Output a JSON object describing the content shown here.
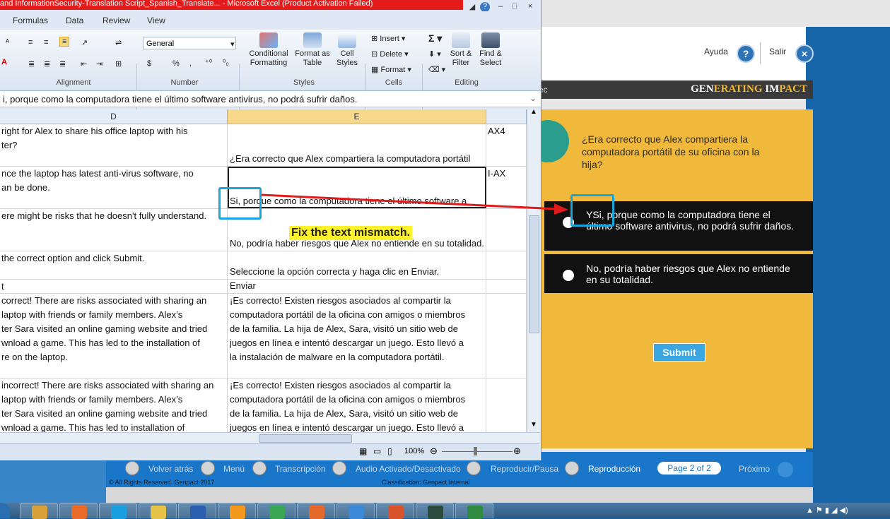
{
  "excel": {
    "title": "and InformationSecurity-Translation Script_Spanish_Translate...  -  Microsoft Excel (Product Activation Failed)",
    "window_controls": [
      "?",
      "–",
      "□",
      "×"
    ],
    "menu": [
      "Formulas",
      "Data",
      "Review",
      "View"
    ],
    "ribbon": {
      "number_format": "General",
      "groups": [
        "Alignment",
        "Number",
        "Styles",
        "Cells",
        "Editing"
      ],
      "styles_buttons": [
        "Conditional Formatting",
        "Format as Table",
        "Cell Styles"
      ],
      "cells_buttons": [
        "Insert",
        "Delete",
        "Format"
      ],
      "editing_buttons": [
        "Sort & Filter",
        "Find & Select"
      ],
      "number_symbols": [
        "$",
        "%",
        ","
      ]
    },
    "formula_bar": "i, porque como la computadora tiene el último software antivirus, no podrá sufrir daños.",
    "columns": [
      "D",
      "E"
    ],
    "rows": [
      {
        "d": [
          "right for Alex to share his office laptop with his",
          "ter?"
        ],
        "e_bottom": "¿Era correcto que Alex compartiera la computadora portátil",
        "f": "AX4",
        "h": 60
      },
      {
        "d": [
          "nce the laptop has latest anti-virus software, no",
          "an be done."
        ],
        "e_bottom": "Si, porque como la computadora tiene el último software a",
        "f": "I-AX",
        "h": 60
      },
      {
        "d": [
          "ere might be risks that he doesn't fully understand."
        ],
        "e_bottom": "No, podría haber riesgos que Alex no entiende en su totalidad.",
        "f": "",
        "h": 60
      },
      {
        "d": [
          "the correct option and click Submit."
        ],
        "e_bottom": "Seleccione la opción correcta y haga clic en Enviar.",
        "f": "",
        "h": 40
      },
      {
        "d": [
          "t"
        ],
        "e_bottom": "Enviar",
        "f": "",
        "h": 20
      },
      {
        "d": [
          "correct! There are risks associated with sharing an",
          "laptop with friends or family members. Alex’s",
          "ter Sara visited an online gaming website and tried",
          "wnload a game. This has led to the installation of",
          "re on the laptop."
        ],
        "e_lines": [
          "¡Es correcto! Existen riesgos asociados al compartir la",
          "computadora portátil de la oficina con amigos o miembros",
          "de la familia. La hija de Alex, Sara, visitó un sitio web de",
          "juegos en línea e intentó descargar un juego. Esto llevó a",
          "la instalación de malware en la computadora portátil."
        ],
        "f": "",
        "h": 120
      },
      {
        "d": [
          "incorrect! There are risks associated with sharing an",
          "laptop with friends or family members. Alex’s",
          "ter Sara visited an online gaming website and tried",
          "wnload a game. This has led to installation of"
        ],
        "e_lines": [
          "¡Es correcto! Existen riesgos asociados al compartir la",
          "computadora portátil de la oficina con amigos o miembros",
          "de la familia. La hija de Alex, Sara, visitó un sitio web de",
          "juegos en línea e intentó descargar un juego. Esto llevó a"
        ],
        "f": "",
        "h": 80
      }
    ],
    "zoom": "100%"
  },
  "annotation": {
    "text": "Fix the text mismatch.",
    "colors": {
      "highlight_box": "#1aa4dc",
      "arrow": "#e01b1b",
      "callout_bg": "#fdf22b"
    }
  },
  "course": {
    "help_label": "Ayuda",
    "exit_label": "Salir",
    "brand": {
      "part1": "GEN",
      "part2": "ERATING ",
      "part3": "IM",
      "part4": "PACT"
    },
    "bar_text": "ec",
    "question": "¿Era correcto que Alex compartiera la computadora portátil de su oficina con la hija?",
    "options": [
      "YSi, porque como la computadora tiene el último software antivirus, no podrá sufrir daños.",
      "No, podría haber riesgos que Alex no entiende en su totalidad."
    ],
    "submit": "Submit",
    "nav": {
      "back": "Volver atrás",
      "menu": "Menú",
      "transcript": "Transcripción",
      "audio": "Audio Activado/Desactivado",
      "play": "Reproducir/Pausa",
      "replay": "Reproducción",
      "page": "Page 2 of 2",
      "next": "Próximo"
    },
    "footer_left": "© All Rights Reserved. Genpact 2017",
    "footer_right": "Classification: Genpact Internal",
    "colors": {
      "stage": "#f0b93b",
      "option_bg": "#111111",
      "nav": "#1976c8",
      "submit": "#3aa7e0"
    }
  },
  "taskbar": {
    "apps": [
      "windows-explorer-icon",
      "media-player-icon",
      "skype-icon",
      "folder-icon",
      "word-icon",
      "vlc-icon",
      "chrome-icon",
      "firefox-icon",
      "internet-explorer-icon",
      "powerpoint-icon",
      "terminal-icon",
      "excel-icon"
    ]
  }
}
